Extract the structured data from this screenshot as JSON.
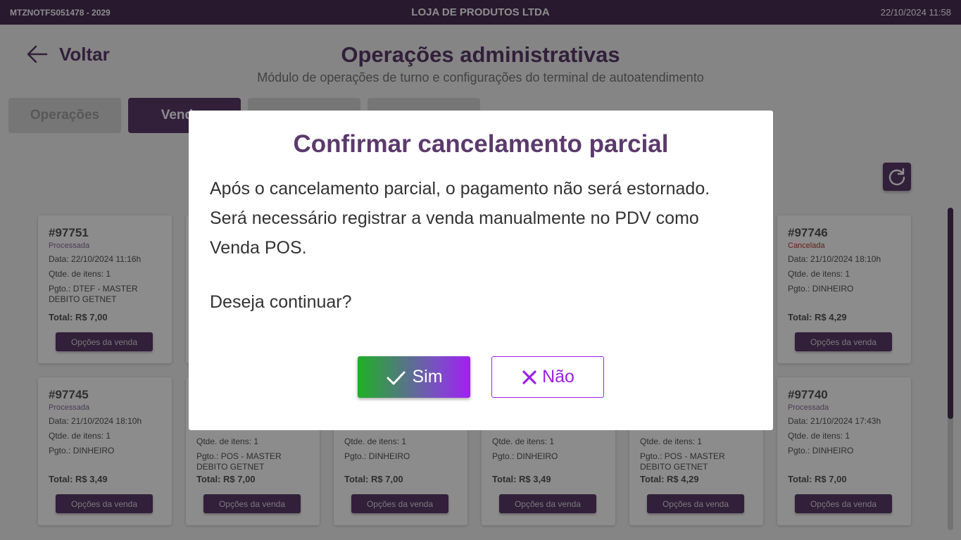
{
  "topbar": {
    "terminal_id": "MTZNOTFS051478 - 2029",
    "store_name": "LOJA DE PRODUTOS LTDA",
    "datetime": "22/10/2024 11:58"
  },
  "header": {
    "back_label": "Voltar",
    "title": "Operações administrativas",
    "subtitle": "Módulo de operações de turno e configurações do terminal de autoatendimento"
  },
  "tabs": [
    {
      "label": "Operações",
      "active": false
    },
    {
      "label": "Vendas",
      "active": true
    },
    {
      "label": "",
      "active": false
    },
    {
      "label": "",
      "active": false
    }
  ],
  "cards": [
    {
      "num": "#97751",
      "status": "Processada",
      "lines": [
        "Data: 22/10/2024 11:16h",
        "Qtde. de itens: 1",
        "Pgto.: DTEF - MASTER DEBITO GETNET"
      ],
      "total": "Total: R$ 7,00"
    },
    {
      "num": "#97746",
      "status": "Cancelada",
      "lines": [
        "Data: 21/10/2024 18:10h",
        "Qtde. de itens: 1",
        "Pgto.: DINHEIRO"
      ],
      "total": "Total: R$ 4,29"
    },
    {
      "num": "#97745",
      "status": "Processada",
      "lines": [
        "Data: 21/10/2024 18:10h",
        "Qtde. de itens: 1",
        "Pgto.: DINHEIRO"
      ],
      "total": "Total: R$ 3,49"
    },
    {
      "num": "",
      "status": "",
      "lines": [
        "Qtde. de itens: 1",
        "Pgto.: POS - MASTER DEBITO GETNET"
      ],
      "total": "Total: R$ 7,00"
    },
    {
      "num": "",
      "status": "",
      "lines": [
        "Qtde. de itens: 1",
        "Pgto.: DINHEIRO"
      ],
      "total": "Total: R$ 7,00"
    },
    {
      "num": "",
      "status": "",
      "lines": [
        "Qtde. de itens: 1",
        "Pgto.: DINHEIRO"
      ],
      "total": "Total: R$ 3,49"
    },
    {
      "num": "",
      "status": "",
      "lines": [
        "Qtde. de itens: 1",
        "Pgto.: POS - MASTER DEBITO GETNET"
      ],
      "total": "Total: R$ 4,29"
    },
    {
      "num": "#97740",
      "status": "Processada",
      "lines": [
        "Data: 21/10/2024 17:43h",
        "Qtde. de itens: 1",
        "Pgto.: DINHEIRO"
      ],
      "total": "Total: R$ 7,00"
    }
  ],
  "card_option_label": "Opções da venda",
  "dialog": {
    "title": "Confirmar cancelamento parcial",
    "message": "Após o cancelamento parcial, o pagamento não será estornado. Será necessário registrar a venda manualmente no PDV como Venda POS.",
    "question": "Deseja continuar?",
    "yes_label": "Sim",
    "no_label": "Não"
  },
  "colors": {
    "brand": "#5b3a6b",
    "topbar": "#4a2f57",
    "yes_gradient_start": "#1fb025",
    "yes_gradient_end": "#a020f0",
    "no_accent": "#a020f0"
  }
}
